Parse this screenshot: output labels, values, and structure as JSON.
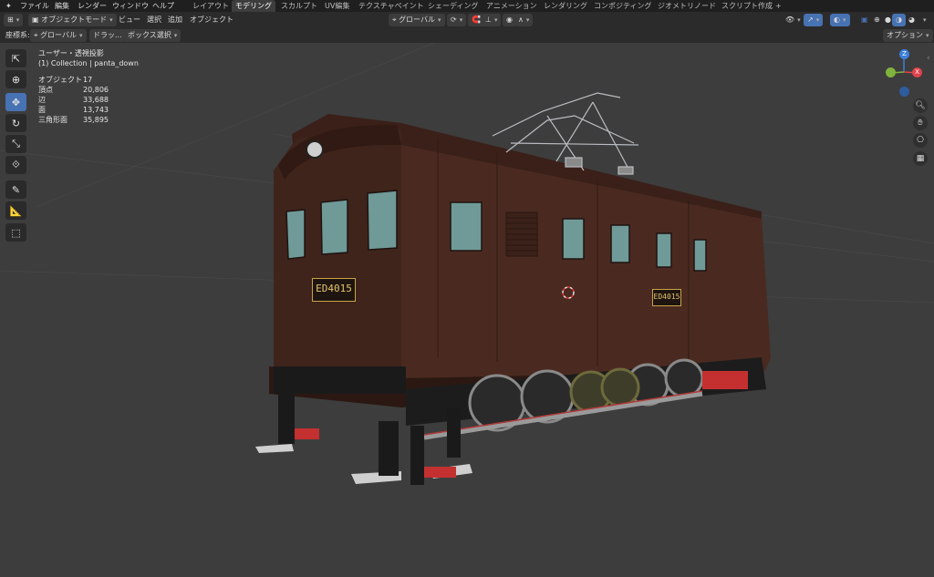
{
  "menu": {
    "items": [
      "ファイル",
      "編集",
      "レンダー",
      "ウィンドウ",
      "ヘルプ"
    ]
  },
  "workspace_tabs": [
    "レイアウト",
    "モデリング",
    "スカルプト",
    "UV編集",
    "テクスチャペイント",
    "シェーディング",
    "アニメーション",
    "レンダリング",
    "コンポジティング",
    "ジオメトリノード",
    "スクリプト作成"
  ],
  "active_tab": "モデリング",
  "header": {
    "mode": "オブジェクトモード",
    "view": "ビュー",
    "select": "選択",
    "add": "追加",
    "object": "オブジェクト",
    "transform_orientation": "グローバル"
  },
  "toolheader": {
    "coord_label": "座標系:",
    "coord_value": "グローバル",
    "drag_label": "ドラッ...",
    "select_mode": "ボックス選択",
    "options": "オプション"
  },
  "overlay": {
    "view_name": "ユーザー・透視投影",
    "collection": "(1) Collection | panta_down",
    "stats": [
      {
        "label": "オブジェクト",
        "value": "17"
      },
      {
        "label": "頂点",
        "value": "20,806"
      },
      {
        "label": "辺",
        "value": "33,688"
      },
      {
        "label": "面",
        "value": "13,743"
      },
      {
        "label": "三角形面",
        "value": "35,895"
      }
    ]
  },
  "locomotive": {
    "plate_front": "ED4015",
    "plate_side": "ED4015"
  },
  "gizmo": {
    "z": "Z",
    "x": "X",
    "colors": {
      "x": "#e0434c",
      "y": "#7fb33d",
      "z": "#3d7fdb"
    }
  },
  "colors": {
    "accent": "#4772b3",
    "body": "#4a2a20",
    "body_dark": "#3a2019",
    "background": "#3d3d3d"
  }
}
